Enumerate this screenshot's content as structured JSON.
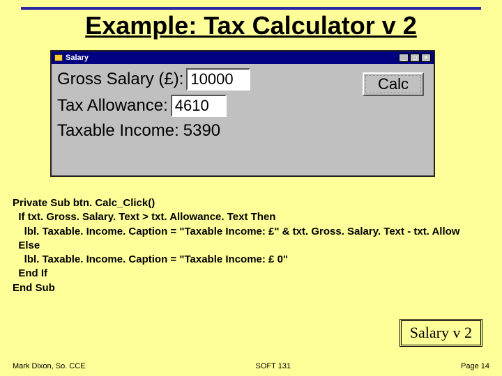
{
  "title": "Example: Tax Calculator v 2",
  "window": {
    "caption": "Salary",
    "min_glyph": "_",
    "max_glyph": "□",
    "close_glyph": "×",
    "gross_label": "Gross Salary (£):",
    "gross_value": "10000",
    "allowance_label": "Tax Allowance:",
    "allowance_value": "4610",
    "taxable_label": "Taxable Income:",
    "taxable_value": "5390",
    "calc_label": "Calc"
  },
  "code": {
    "l1": "Private Sub btn. Calc_Click()",
    "l2": "  If txt. Gross. Salary. Text > txt. Allowance. Text Then",
    "l3": "    lbl. Taxable. Income. Caption = \"Taxable Income: £\" & txt. Gross. Salary. Text - txt. Allow",
    "l4": "  Else",
    "l5": "    lbl. Taxable. Income. Caption = \"Taxable Income: £ 0\"",
    "l6": "  End If",
    "l7": "End Sub"
  },
  "badge": "Salary v 2",
  "footer": {
    "left": "Mark Dixon, So. CCE",
    "center": "SOFT 131",
    "right": "Page 14"
  }
}
